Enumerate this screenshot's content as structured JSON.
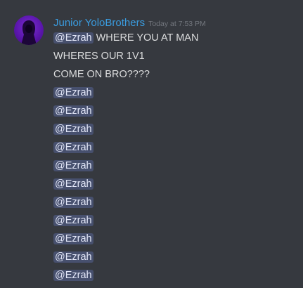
{
  "message": {
    "author": "Junior YoloBrothers",
    "timestamp": "Today at 7:53 PM",
    "avatar_icon": "hooded-figure-icon",
    "colors": {
      "background": "#36393f",
      "username": "#3a9bde",
      "text": "#dcddde",
      "timestamp": "#72767d",
      "mention_bg": "rgba(114,137,218,0.3)"
    },
    "lines": [
      {
        "mention": "@Ezrah",
        "text": "WHERE YOU AT MAN"
      },
      {
        "text": "WHERES OUR 1V1"
      },
      {
        "text": "COME ON BRO????"
      },
      {
        "mention": "@Ezrah"
      },
      {
        "mention": "@Ezrah"
      },
      {
        "mention": "@Ezrah"
      },
      {
        "mention": "@Ezrah"
      },
      {
        "mention": "@Ezrah"
      },
      {
        "mention": "@Ezrah"
      },
      {
        "mention": "@Ezrah"
      },
      {
        "mention": "@Ezrah"
      },
      {
        "mention": "@Ezrah"
      },
      {
        "mention": "@Ezrah"
      },
      {
        "mention": "@Ezrah"
      }
    ]
  }
}
